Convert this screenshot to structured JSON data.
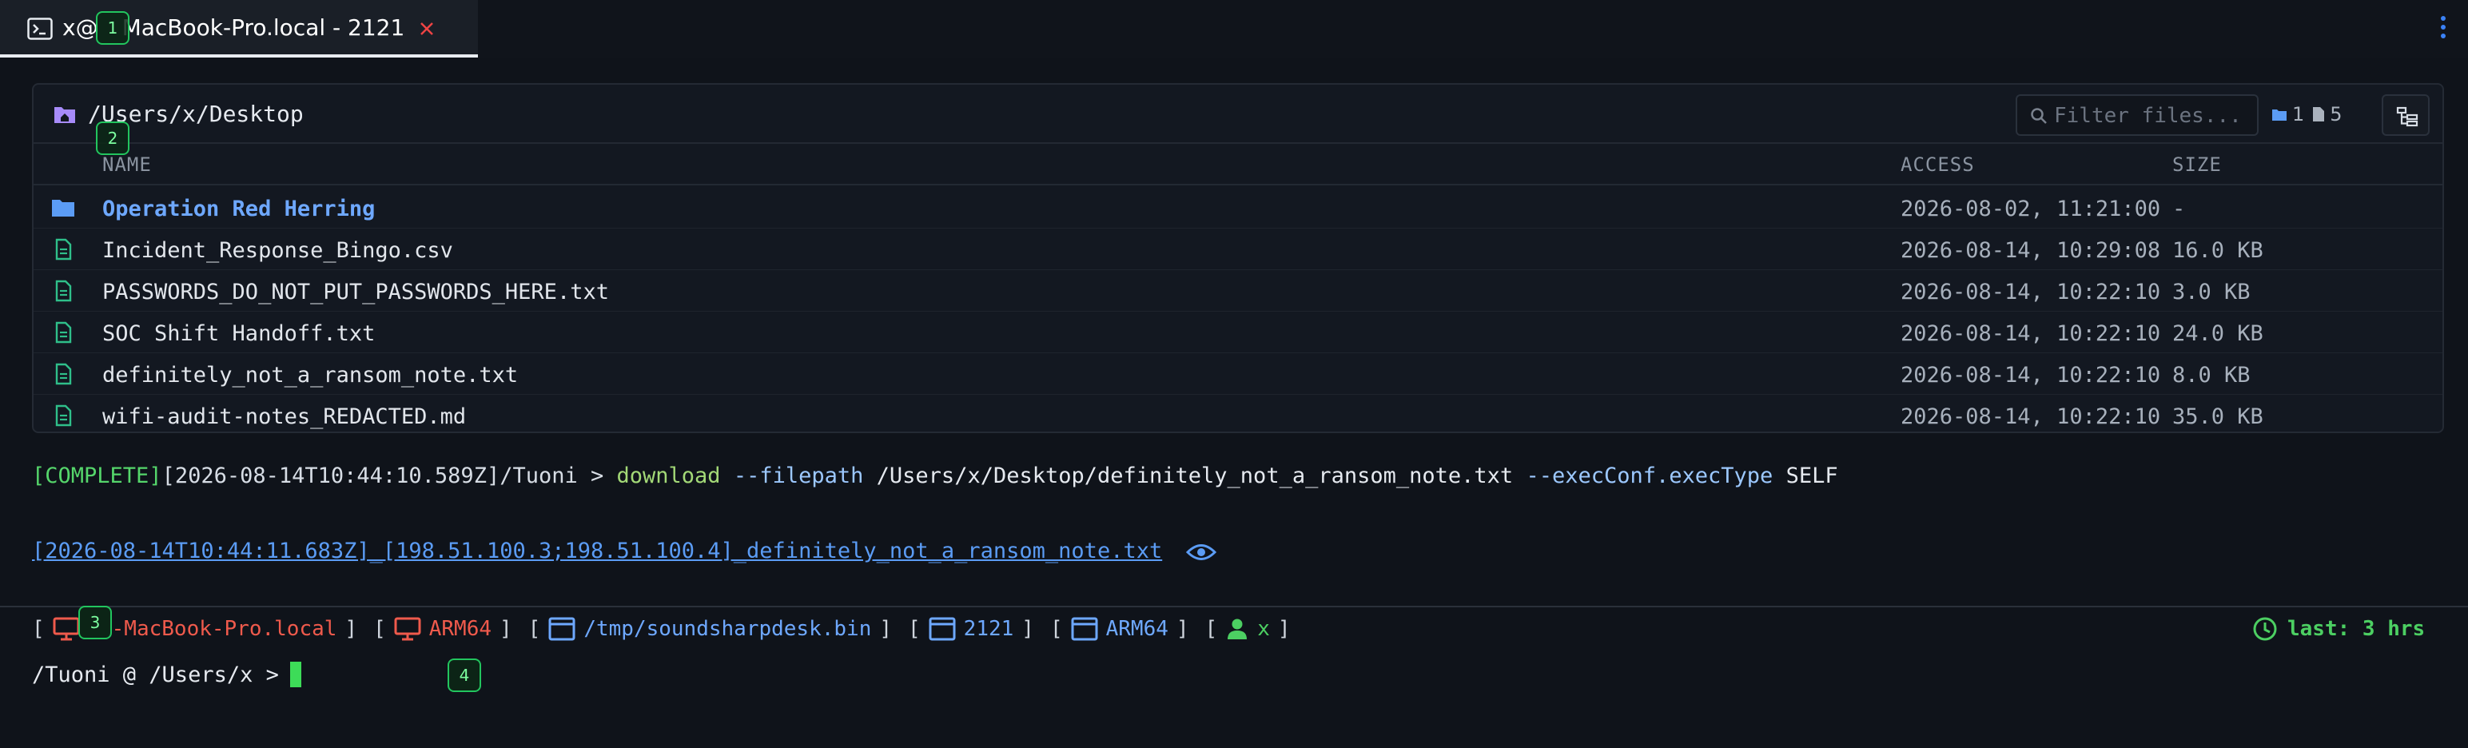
{
  "tab": {
    "title": "x@",
    "title_rest": "MacBook-Pro.local - 2121",
    "icon": "terminal-icon",
    "close_icon": "close-icon"
  },
  "markers": [
    "1",
    "2",
    "3",
    "4"
  ],
  "panel": {
    "path": "/Users/x/Desktop",
    "filter_placeholder": "Filter files...",
    "folder_count": "1",
    "file_count": "5",
    "columns": {
      "name": "NAME",
      "access": "ACCESS",
      "size": "SIZE"
    },
    "rows": [
      {
        "type": "folder",
        "name": "Operation Red Herring",
        "access": "2026-08-02, 11:21:00",
        "size": "-"
      },
      {
        "type": "file",
        "name": "Incident_Response_Bingo.csv",
        "access": "2026-08-14, 10:29:08",
        "size": "16.0 KB"
      },
      {
        "type": "file",
        "name": "PASSWORDS_DO_NOT_PUT_PASSWORDS_HERE.txt",
        "access": "2026-08-14, 10:22:10",
        "size": "3.0 KB"
      },
      {
        "type": "file",
        "name": "SOC Shift Handoff.txt",
        "access": "2026-08-14, 10:22:10",
        "size": "24.0 KB"
      },
      {
        "type": "file",
        "name": "definitely_not_a_ransom_note.txt",
        "access": "2026-08-14, 10:22:10",
        "size": "8.0 KB"
      },
      {
        "type": "file",
        "name": "wifi-audit-notes_REDACTED.md",
        "access": "2026-08-14, 10:22:10",
        "size": "35.0 KB"
      }
    ]
  },
  "command": {
    "status": "[COMPLETE]",
    "context": "[2026-08-14T10:44:10.589Z]/Tuoni > ",
    "keyword": "download",
    "flag1": "--filepath",
    "arg1": "/Users/x/Desktop/definitely_not_a_ransom_note.txt",
    "flag2": "--execConf.execType",
    "arg2": "SELF"
  },
  "download_link": "[2026-08-14T10:44:11.683Z]_[198.51.100.3;198.51.100.4]_definitely_not_a_ransom_note.txt",
  "status_bar": {
    "host": "-MacBook-Pro.local",
    "arch1": "ARM64",
    "binary": "/tmp/soundsharpdesk.bin",
    "pid": "2121",
    "arch2": "ARM64",
    "user": "x",
    "last_seen": "last: 3 hrs"
  },
  "prompt": "/Tuoni @ /Users/x >",
  "colors": {
    "accent_green": "#55d66b",
    "link_blue": "#5b9cf5",
    "error_red": "#ef5a4c"
  }
}
